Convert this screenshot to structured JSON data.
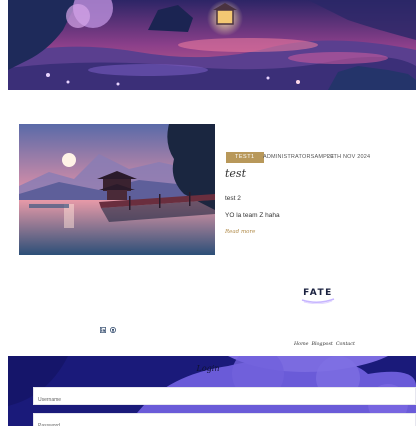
{
  "post": {
    "category": "TEST1",
    "author": "ADMINISTRATORSAMPLE",
    "date": "20TH NOV 2024",
    "title": "test",
    "subtitle": "test 2",
    "excerpt": "YO la team Z haha",
    "read_more": "Read more"
  },
  "brand": {
    "logo_text": "FATE"
  },
  "social": {
    "icons": [
      "linkedin-icon",
      "github-icon"
    ]
  },
  "footer_nav": [
    "Home",
    "Blogpost",
    "Contact"
  ],
  "login": {
    "title": "Login",
    "username_placeholder": "Username",
    "password_placeholder": "Password"
  },
  "colors": {
    "accent_gold": "#b8985a",
    "footer_blue": "#1a1a7a",
    "footer_purple": "#6b5bd6"
  }
}
